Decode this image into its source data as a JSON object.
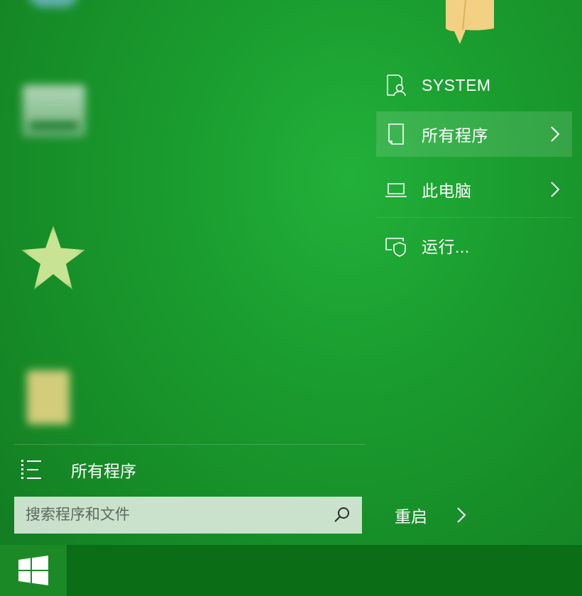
{
  "right_menu": {
    "user": {
      "label": "SYSTEM",
      "icon": "user-document-icon"
    },
    "all_programs": {
      "label": "所有程序",
      "icon": "document-icon",
      "highlighted": true
    },
    "this_pc": {
      "label": "此电脑",
      "icon": "laptop-icon"
    },
    "run": {
      "label": "运行...",
      "icon": "run-shield-icon"
    }
  },
  "left_menu": {
    "all_programs_label": "所有程序",
    "search_placeholder": "搜索程序和文件"
  },
  "power": {
    "restart_label": "重启"
  },
  "colors": {
    "background": "#1a9c2e",
    "taskbar": "#0b6e17",
    "start_button": "#1b8a26",
    "search_box": "#e8f0e8"
  }
}
